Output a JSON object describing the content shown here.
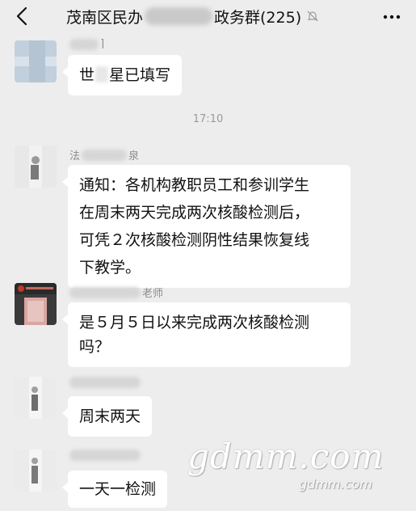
{
  "header": {
    "title_left": "茂南区民办",
    "title_right": "政务群(225)",
    "icons": [
      "back-arrow-icon",
      "mute-bell-icon",
      "more-dots-icon"
    ]
  },
  "timestamp": "17:10",
  "messages": [
    {
      "sender": "",
      "text_a": "世",
      "text_b": "星已填写"
    },
    {
      "sender_a": "法",
      "sender_b": "泉",
      "text": "通知：各机构教职员工和参训学生\n在周末两天完成两次核酸检测后，\n可凭２次核酸检测阴性结果恢复线\n下教学。"
    },
    {
      "sender_b": "老师",
      "text": "是５月５日以来完成两次核酸检测\n吗？"
    },
    {
      "text": "周末两天"
    },
    {
      "text": "一天一检测"
    }
  ],
  "watermark": {
    "big": "gdmm.com",
    "small": "gdmm.com"
  }
}
